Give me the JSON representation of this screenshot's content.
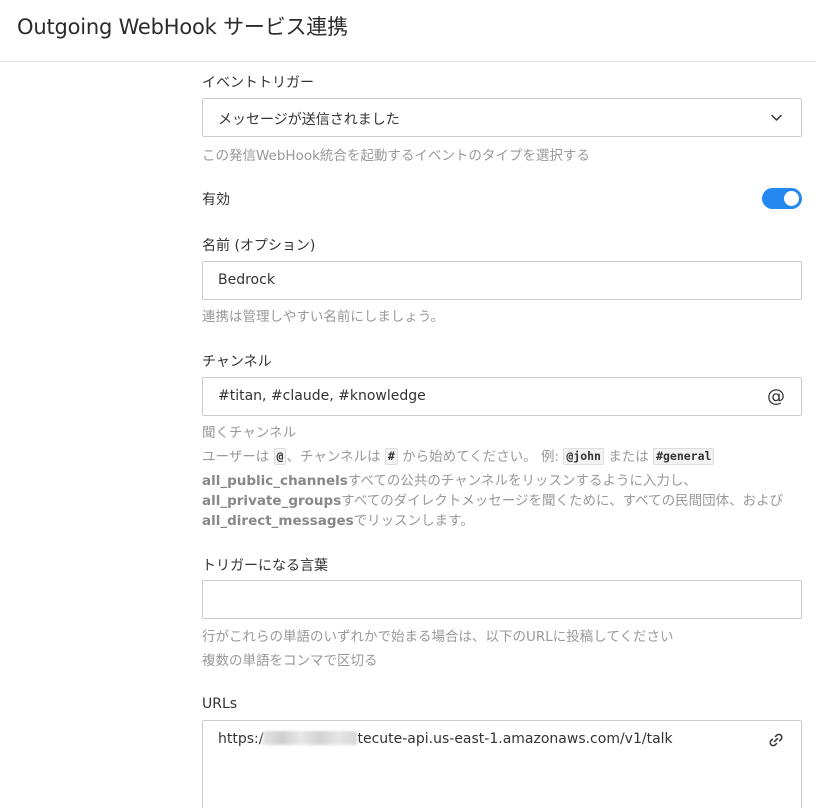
{
  "page": {
    "title": "Outgoing WebHook サービス連携"
  },
  "event_trigger": {
    "label": "イベントトリガー",
    "value": "メッセージが送信されました",
    "hint": "この発信WebHook統合を起動するイベントのタイプを選択する"
  },
  "enabled": {
    "label": "有効",
    "on": true
  },
  "name": {
    "label": "名前 (オプション)",
    "value": "Bedrock",
    "hint": "連携は管理しやすい名前にしましょう。"
  },
  "channel": {
    "label": "チャンネル",
    "value": "#titan, #claude, #knowledge",
    "hint_title": "聞くチャンネル",
    "hint_line1_a": "ユーザーは",
    "hint_line1_code1": "@",
    "hint_line1_b": "、チャンネルは",
    "hint_line1_code2": "#",
    "hint_line1_c": "から始めてください。 例:",
    "hint_line1_code3": "@john",
    "hint_line1_d": "または",
    "hint_line1_code4": "#general",
    "hint_line2_bold": "all_public_channels",
    "hint_line2_text": "すべての公共のチャンネルをリッスンするように入力し、",
    "hint_line3_bold": "all_private_groups",
    "hint_line3_text": "すべてのダイレクトメッセージを聞くために、すべての民間団体、および",
    "hint_line4_bold": "all_direct_messages",
    "hint_line4_text": "でリッスンします。"
  },
  "trigger_words": {
    "label": "トリガーになる言葉",
    "value": "",
    "hint1": "行がこれらの単語のいずれかで始まる場合は、以下のURLに投稿してください",
    "hint2": "複数の単語をコンマで区切る"
  },
  "urls": {
    "label": "URLs",
    "value_prefix": "https:/",
    "value_suffix": "tecute-api.us-east-1.amazonaws.com/v1/talk"
  },
  "colors": {
    "accent": "#2389f0",
    "hint_text": "#999999",
    "border": "#cccccc"
  },
  "icons": {
    "select": "chevron-down-icon",
    "channel": "at-sign-icon",
    "url": "link-icon"
  }
}
